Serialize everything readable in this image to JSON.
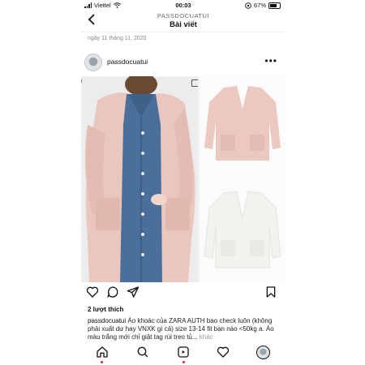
{
  "status_bar": {
    "carrier": "Viettel",
    "time": "00:03",
    "battery": "67%"
  },
  "header": {
    "username_caps": "PASSDOCUATUI",
    "title": "Bài viết",
    "back_icon": "chevron-left-icon"
  },
  "post": {
    "date": "ngày 11 tháng 11, 2020",
    "author": "passdocuatui",
    "likes": "2 lượt thích",
    "caption_user": "passdocuatui",
    "caption_text": "Áo khoác của ZARA AUTH bao check luôn (không phải xuất dư hay VNXK gì cả) size 13-14 fit bạn nào <50kg a. Áo màu trắng mới chỉ giặt tag rùi treo tủ...",
    "caption_more": "khác"
  },
  "icons": {
    "like": "heart-icon",
    "comment": "comment-icon",
    "share": "send-icon",
    "save": "bookmark-icon",
    "home": "home-icon",
    "search": "search-icon",
    "reels": "reels-icon",
    "activity": "heart-icon",
    "profile": "avatar"
  },
  "colors": {
    "cardigan_pink": "#e9c6be",
    "denim": "#4a6f9a",
    "notification": "#e0245e"
  }
}
